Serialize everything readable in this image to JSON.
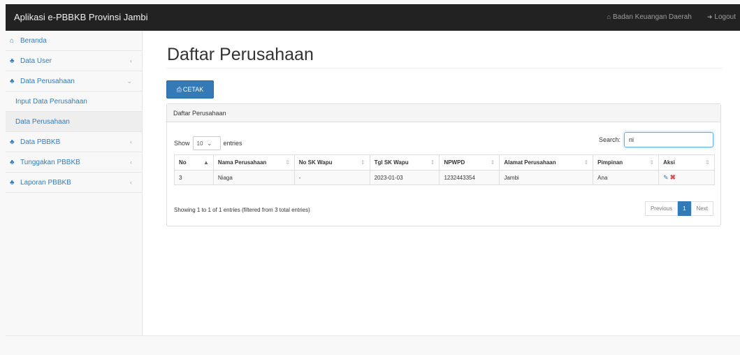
{
  "header": {
    "brand": "Aplikasi e-PBBKB Provinsi Jambi",
    "user_label": "Badan Keuangan Daerah",
    "logout_label": "Logout"
  },
  "sidebar": {
    "items": [
      {
        "label": "Beranda",
        "icon": "home-icon",
        "has_chevron": false
      },
      {
        "label": "Data User",
        "icon": "users-icon",
        "has_chevron": true
      },
      {
        "label": "Data Perusahaan",
        "icon": "users-icon",
        "has_chevron": true
      },
      {
        "label": "Input Data Perusahaan",
        "sub": true
      },
      {
        "label": "Data Perusahaan",
        "sub": true,
        "active": true
      },
      {
        "label": "Data PBBKB",
        "icon": "users-icon",
        "has_chevron": true
      },
      {
        "label": "Tunggakan PBBKB",
        "icon": "users-icon",
        "has_chevron": true
      },
      {
        "label": "Laporan PBBKB",
        "icon": "users-icon",
        "has_chevron": true
      }
    ]
  },
  "main": {
    "title": "Daftar Perusahaan",
    "print_button": "CETAK",
    "panel_heading": "Daftar Perusahaan",
    "show_label": "Show",
    "entries_value": "10",
    "entries_label": "entries",
    "search_label": "Search:",
    "search_value": "ni",
    "columns": [
      "No",
      "Nama Perusahaan",
      "No SK Wapu",
      "Tgl SK Wapu",
      "NPWPD",
      "Alamat Perusahaan",
      "Pimpinan",
      "Aksi"
    ],
    "rows": [
      {
        "no": "3",
        "nama": "Niaga",
        "no_sk": "-",
        "tgl_sk": "2023-01-03",
        "npwpd": "1232443354",
        "alamat": "Jambi",
        "pimpinan": "Ana"
      }
    ],
    "info": "Showing 1 to 1 of 1 entries (filtered from 3 total entries)",
    "pagination": {
      "previous": "Previous",
      "current": "1",
      "next": "Next"
    }
  },
  "colors": {
    "primary": "#337ab7",
    "navbar": "#222222",
    "danger": "#d9534f"
  }
}
